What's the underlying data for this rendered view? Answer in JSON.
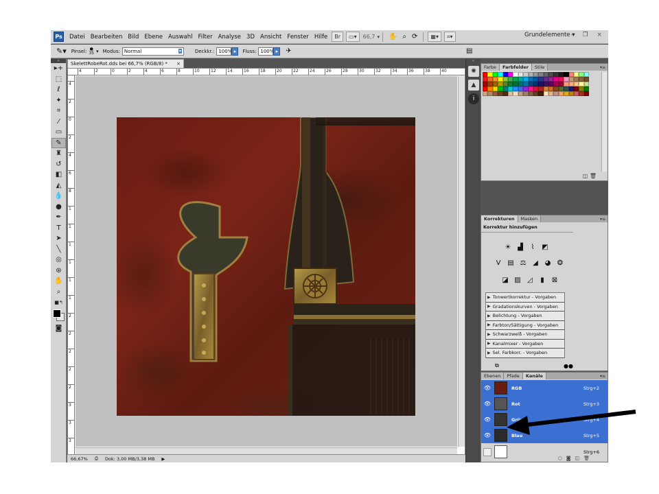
{
  "menubar": {
    "logo": "Ps",
    "items": [
      "Datei",
      "Bearbeiten",
      "Bild",
      "Ebene",
      "Auswahl",
      "Filter",
      "Analyse",
      "3D",
      "Ansicht",
      "Fenster",
      "Hilfe"
    ],
    "br_label": "Br",
    "zoom": "66,7",
    "workspace": "Grundelemente",
    "window_controls": "– ❐ ×"
  },
  "options": {
    "brush_label": "Pinsel:",
    "brush_size": "35",
    "mode_label": "Modus:",
    "mode_value": "Normal",
    "opacity_label": "Deckkr.:",
    "opacity_value": "100%",
    "flow_label": "Fluss:",
    "flow_value": "100%"
  },
  "document": {
    "tab_title": "SkelettRobeRot.dds bei 66,7% (RGB/8) *",
    "zoom_status": "66,67%",
    "doc_info": "Dok: 3,00 MB/3,38 MB"
  },
  "rulers": {
    "top": [
      "4",
      "2",
      "0",
      "2",
      "4",
      "6",
      "8",
      "10",
      "12",
      "14",
      "16",
      "18",
      "20",
      "22",
      "24",
      "26",
      "28",
      "30",
      "32",
      "34",
      "36",
      "38",
      "40"
    ],
    "left": [
      "4",
      "2",
      "0",
      "2",
      "4",
      "6",
      "8",
      "1",
      "1",
      "1",
      "1",
      "1",
      "1",
      "2",
      "2",
      "2",
      "2",
      "2",
      "3",
      "3",
      "3"
    ]
  },
  "swatches_panel": {
    "tabs": [
      "Farbe",
      "Farbfelder",
      "Stile"
    ],
    "active_tab": "Farbfelder",
    "colors": [
      "#ff0000",
      "#ffff00",
      "#00ff00",
      "#00ffff",
      "#0000ff",
      "#ff00ff",
      "#ffffff",
      "#e6e6e6",
      "#cccccc",
      "#b3b3b3",
      "#999999",
      "#808080",
      "#666666",
      "#4d4d4d",
      "#333333",
      "#1a1a1a",
      "#000000",
      "#ff8080",
      "#ffff80",
      "#80ff80",
      "#80ffff",
      "#ed1c24",
      "#f26522",
      "#f7941d",
      "#fff200",
      "#8dc63f",
      "#39b54a",
      "#00a651",
      "#00a99d",
      "#00aeef",
      "#0072bc",
      "#0054a6",
      "#2e3192",
      "#662d91",
      "#92278f",
      "#ec008c",
      "#ed145b",
      "#f49ac1",
      "#c69c6d",
      "#a67c52",
      "#8c6239",
      "#754c24",
      "#9e0b0f",
      "#a0410d",
      "#a36209",
      "#aba000",
      "#598527",
      "#197b30",
      "#007236",
      "#00746b",
      "#0076a3",
      "#004a80",
      "#003471",
      "#1b1464",
      "#440e62",
      "#630460",
      "#9e005d",
      "#9e0039",
      "#f7977a",
      "#fbad82",
      "#fdc689",
      "#fff799",
      "#c4df9b",
      "#ff0000",
      "#ff7f00",
      "#ffd700",
      "#00c000",
      "#008080",
      "#00ced1",
      "#1e90ff",
      "#4169e1",
      "#8a2be2",
      "#ff1493",
      "#dc143c",
      "#b22222",
      "#cd853f",
      "#d2691e",
      "#8b4513",
      "#556b2f",
      "#2f4f4f",
      "#191970",
      "#800000",
      "#808000",
      "#008000",
      "#c8a882",
      "#b08860",
      "#906040",
      "#704020",
      "#503010",
      "#e0c0a0",
      "#f0e0c0",
      "#c0a080",
      "#a08060",
      "#806040",
      "#604020",
      "#402000",
      "#ffe4c4",
      "#deb887",
      "#bc8f8f",
      "#f4a460",
      "#daa520",
      "#b8860b",
      "#cd5c5c",
      "#a52a2a",
      "#800000"
    ]
  },
  "adjustments_panel": {
    "tabs": [
      "Korrekturen",
      "Masken"
    ],
    "active_tab": "Korrekturen",
    "heading": "Korrektur hinzufügen",
    "presets": [
      "Tonwertkorrektur - Vorgaben",
      "Gradationskurven - Vorgaben",
      "Belichtung - Vorgaben",
      "Farbton/Sättigung - Vorgaben",
      "Schwarzweiß - Vorgaben",
      "Kanalmixer - Vorgaben",
      "Sel. Farbkorr. - Vorgaben"
    ]
  },
  "channels_panel": {
    "tabs": [
      "Ebenen",
      "Pfade",
      "Kanäle"
    ],
    "active_tab": "Kanäle",
    "channels": [
      {
        "name": "RGB",
        "shortcut": "Strg+2",
        "selected": true
      },
      {
        "name": "Rot",
        "shortcut": "Strg+3",
        "selected": true
      },
      {
        "name": "Grün",
        "shortcut": "Strg+4",
        "selected": true
      },
      {
        "name": "Blau",
        "shortcut": "Strg+5",
        "selected": true
      },
      {
        "name": "",
        "shortcut": "Strg+6",
        "selected": false
      }
    ]
  },
  "colors": {
    "selection_blue": "#3c6fd2",
    "app_dark": "#535353",
    "panel_light": "#d4d4d4",
    "robe_red": "#6b1c12",
    "annotation_arrow": "#000000"
  }
}
